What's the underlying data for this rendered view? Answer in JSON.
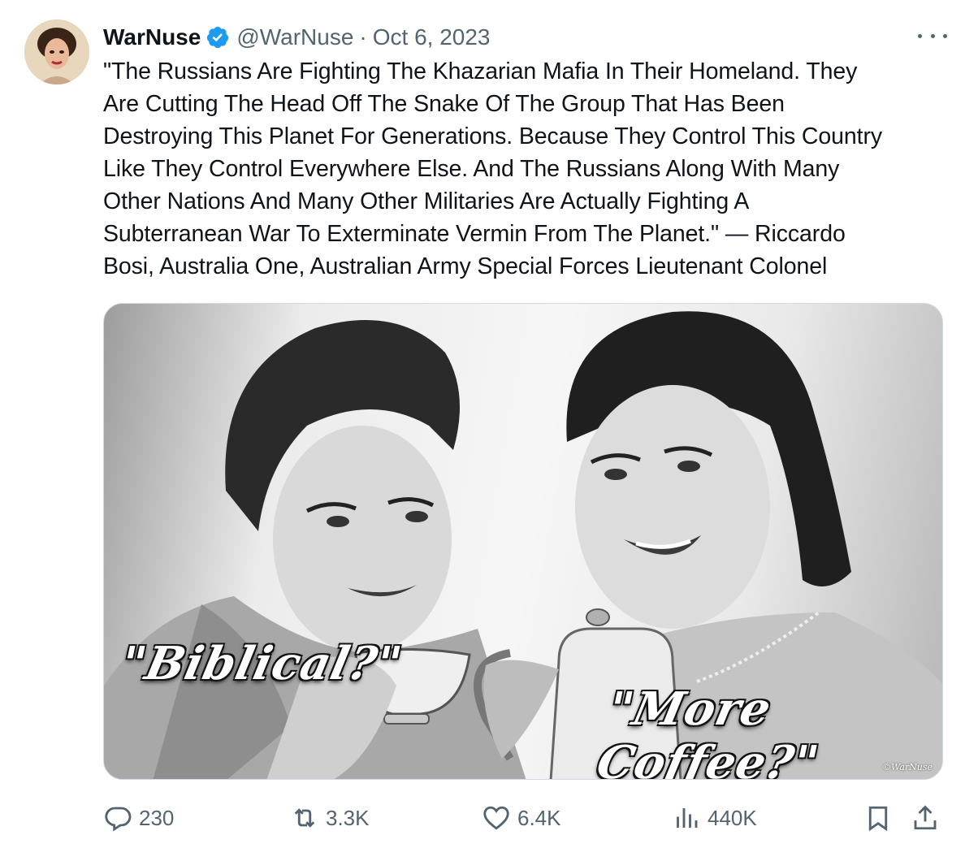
{
  "tweet": {
    "author_name": "WarNuse",
    "handle": "@WarNuse",
    "separator": "·",
    "date": "Oct 6, 2023",
    "text_lines": [
      "\"The Russians Are Fighting The Khazarian Mafia In Their Homeland. They",
      "Are Cutting The Head Off The Snake Of The Group That Has Been",
      "Destroying This Planet For Generations. Because They Control This Country",
      "Like They Control Everywhere Else. And The Russians Along With Many",
      "Other Nations And Many Other Militaries Are Actually Fighting A",
      "Subterranean War To Exterminate Vermin From The Planet.\" — Riccardo",
      "Bosi, Australia One, Australian Army Special Forces Lieutenant Colonel"
    ],
    "media": {
      "caption_left": "\"Biblical?\"",
      "caption_right": "\"More Coffee?\"",
      "watermark": "©WarNuse"
    },
    "stats": {
      "replies": "230",
      "reposts": "3.3K",
      "likes": "6.4K",
      "views": "440K"
    },
    "icons": {
      "verified": "verified-badge-icon",
      "more": "more-icon",
      "reply": "reply-icon",
      "repost": "repost-icon",
      "like": "heart-icon",
      "views": "views-icon",
      "bookmark": "bookmark-icon",
      "share": "share-icon"
    },
    "colors": {
      "verified": "#1d9bf0",
      "text": "#0f1419",
      "secondary": "#536471"
    }
  }
}
